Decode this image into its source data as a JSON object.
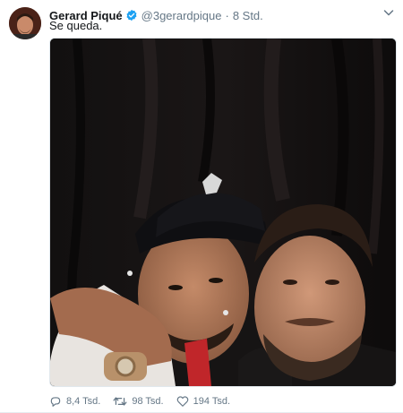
{
  "tweet": {
    "author_name": "Gerard Piqué",
    "handle": "@3gerardpique",
    "separator": "·",
    "time": "8 Std.",
    "text": "Se queda.",
    "icons": {
      "verified": "verified-badge-icon",
      "menu": "chevron-down-icon",
      "reply": "reply-icon",
      "retweet": "retweet-icon",
      "like": "heart-icon"
    },
    "colors": {
      "verified": "#1da1f2",
      "muted": "#657786",
      "text": "#14171a"
    }
  },
  "actions": {
    "replies": "8,4 Tsd.",
    "retweets": "98 Tsd.",
    "likes": "194 Tsd."
  }
}
